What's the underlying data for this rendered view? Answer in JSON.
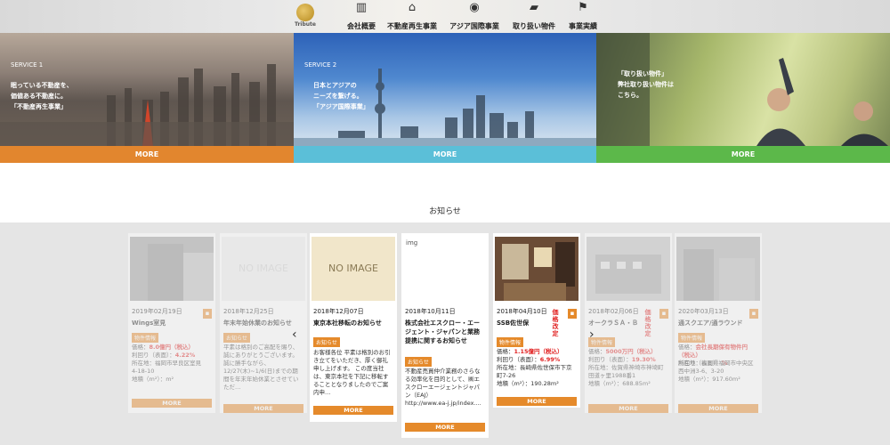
{
  "logo": {
    "text": "Tribute"
  },
  "nav": [
    {
      "label": "会社概要",
      "icon": "building-icon"
    },
    {
      "label": "不動産再生事業",
      "icon": "house-icon"
    },
    {
      "label": "アジア国際事業",
      "icon": "globe-icon"
    },
    {
      "label": "取り扱い物件",
      "icon": "folder-icon"
    },
    {
      "label": "事業実績",
      "icon": "map-pin-icon"
    }
  ],
  "services": [
    {
      "service": "SERVICE 1",
      "caption": "眠っている不動産を、\n価値ある不動産に。\n「不動産再生事業」",
      "more": "MORE",
      "color": "#e2862e"
    },
    {
      "service": "SERVICE 2",
      "caption": "日本とアジアの\nニーズを繋げる。\n「アジア国際事業」",
      "more": "MORE",
      "color": "#5bbfd8"
    },
    {
      "service": "",
      "caption": "「取り扱い物件」\n弊社取り扱い物件は\nこちら。",
      "more": "MORE",
      "color": "#5cb84a"
    }
  ],
  "news": {
    "title": "お知らせ",
    "cards": [
      {
        "date": "2019年02月19日",
        "title": "Wings室見",
        "tag": "物件情報",
        "price_label": "価格：",
        "price": "8.0億円（税込）",
        "yield_label": "利回り（表面）：",
        "yield": "4.22%",
        "body": "所在地：福岡市早良区室見\n4-18-10\n地積（m²）：m²",
        "more": "MORE"
      },
      {
        "date": "2018年12月25日",
        "title": "年末年始休業のお知らせ",
        "tag": "お知らせ",
        "image_text": "NO IMAGE",
        "body": "平素は格別のご高配を賜り、誠にありがとうございます。誠に勝手ながら、12/27(木)~1/6(日)までの期間を年末年始休業とさせていただ…",
        "more": "MORE"
      },
      {
        "date": "2018年12月07日",
        "title": "東京本社移転のお知らせ",
        "tag": "お知らせ",
        "image_text": "NO IMAGE",
        "body": "お客様各位 平素は格別のお引き立てをいただき、厚く御礼申し上げます。 この度当社は、東京本社を下記に移転することとなりましたのでご案内申…",
        "more": "MORE"
      },
      {
        "date": "2018年10月11日",
        "title": "株式会社エスクロー・エージェント・ジャパンと業務提携に関するお知らせ",
        "tag": "お知らせ",
        "image_text": "img",
        "body": "不動産売買仲介業務のさらなる効率化を目的として、㈱エスクローエージェントジャパン（EAJ）\nhttp://www.ea-j.jp/index....",
        "more": "MORE"
      },
      {
        "date": "2018年04月10日",
        "title": "SSB佐世保",
        "tag": "物件情報",
        "badge": "価格改定",
        "price_label": "価格：",
        "price": "1.15億円（税込）",
        "yield_label": "利回り（表面）：",
        "yield": "6.99%",
        "body": "所在地：長崎県佐世保市下京町7-26\n地積（m²）：190.28m²",
        "more": "MORE"
      },
      {
        "date": "2018年02月06日",
        "title": "オークラＳＡ・Ｂ",
        "tag": "物件情報",
        "badge": "価格改定",
        "price_label": "価格：",
        "price": "5000万円（税込）",
        "yield_label": "利回り（表面）：",
        "yield": "19.30%",
        "body": "所在地：佐賀県神埼市神埼町田道ヶ里1988番1\n地積（m²）：688.85m²",
        "more": "MORE"
      },
      {
        "date": "2020年03月13日",
        "title": "通スクエア/通ラウンド",
        "tag": "物件情報",
        "price_label": "価格：",
        "price": "会社長期保有物件円（税込）",
        "yield_label": "利回り（表面）：",
        "yield": "%",
        "body": "所在地：福岡県福岡市中央区西中洲3-6、3-20\n地積（m²）：917.60m²",
        "more": "MORE"
      }
    ]
  }
}
